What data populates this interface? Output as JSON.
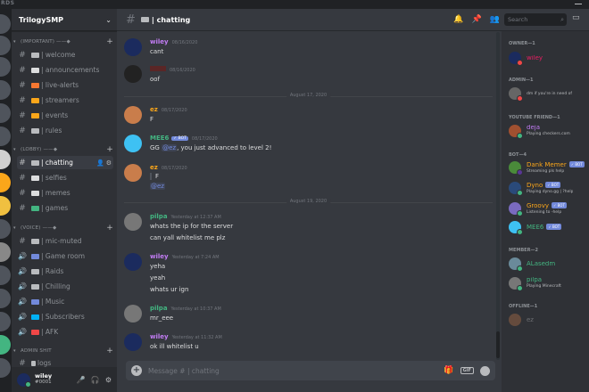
{
  "window": {
    "brand": "RDS"
  },
  "server": {
    "name": "TrilogySMP"
  },
  "categories": {
    "important": "(IMPORTANT) ——◆",
    "lobby": "(LOBBY) ——◆",
    "voice": "(VOICE) ——◆",
    "admin": "ADMIN SHIT"
  },
  "channels": [
    {
      "label": "| welcome",
      "emoji_color": "#b9bbbe"
    },
    {
      "label": "| announcements",
      "emoji_color": "#dcddde"
    },
    {
      "label": "| live-alerts",
      "emoji_color": "#f57731"
    },
    {
      "label": "| streamers",
      "emoji_color": "#faa61a"
    },
    {
      "label": "| events",
      "emoji_color": "#faa61a"
    },
    {
      "label": "| rules",
      "emoji_color": "#b9bbbe"
    },
    {
      "label": "| chatting",
      "emoji_color": "#b9bbbe"
    },
    {
      "label": "| selfies",
      "emoji_color": "#dcddde"
    },
    {
      "label": "| memes",
      "emoji_color": "#dcddde"
    },
    {
      "label": "| games",
      "emoji_color": "#43b581"
    }
  ],
  "voice_channels": [
    {
      "label": "| mic-muted",
      "emoji_color": "#b9bbbe"
    },
    {
      "label": "| Game room",
      "emoji_color": "#7289da"
    },
    {
      "label": "| Raids",
      "emoji_color": "#b9bbbe"
    },
    {
      "label": "| Chilling",
      "emoji_color": "#b9bbbe"
    },
    {
      "label": "| Music",
      "emoji_color": "#7289da"
    },
    {
      "label": "| Subscribers",
      "emoji_color": "#00b0f4"
    },
    {
      "label": "| AFK",
      "emoji_color": "#f04747"
    }
  ],
  "admin_channels": [
    {
      "label": "logs",
      "emoji_color": "#b9bbbe"
    }
  ],
  "user": {
    "name": "wiley",
    "tag": "#0001"
  },
  "header": {
    "channel": "| chatting"
  },
  "search": {
    "placeholder": "Search"
  },
  "messages": [
    {
      "user": "wiley",
      "color": "#c27cf4",
      "time": "08/16/2020",
      "lines": [
        "cant"
      ],
      "avatar": "#1b2b5e"
    },
    {
      "user": "",
      "color": "#f04747",
      "time": "08/16/2020",
      "lines": [
        "oof"
      ],
      "avatar": "#222"
    },
    {
      "divider": "August 17, 2020"
    },
    {
      "user": "ez",
      "color": "#faa61a",
      "time": "08/17/2020",
      "lines": [
        "F"
      ],
      "avatar": "#c97d4b"
    },
    {
      "user": "MEE6",
      "color": "#43b581",
      "bot": "✓ BOT",
      "time": "08/17/2020",
      "lines": [
        "GG ",
        "@ez",
        ", you just advanced to level 2!"
      ],
      "avatar": "#3ec1f3"
    },
    {
      "user": "ez",
      "color": "#faa61a",
      "time": "08/17/2020",
      "lines": [
        "F",
        "@ez"
      ],
      "avatar": "#c97d4b"
    },
    {
      "divider": "August 19, 2020"
    },
    {
      "user": "pilpa",
      "color": "#43b581",
      "time": "Yesterday at 12:37 AM",
      "lines": [
        "whats the ip for the server",
        "can yall whitelist me plz"
      ],
      "avatar": "#777"
    },
    {
      "user": "wiley",
      "color": "#c27cf4",
      "time": "Yesterday at 7:24 AM",
      "lines": [
        "yeha",
        "yeah",
        "whats ur ign"
      ],
      "avatar": "#1b2b5e"
    },
    {
      "user": "pilpa",
      "color": "#43b581",
      "time": "Yesterday at 10:37 AM",
      "lines": [
        "mr_eee"
      ],
      "avatar": "#777"
    },
    {
      "user": "wiley",
      "color": "#c27cf4",
      "time": "Yesterday at 11:32 AM",
      "lines": [
        "ok ill whitelist u"
      ],
      "avatar": "#1b2b5e"
    }
  ],
  "composer": {
    "placeholder": "Message #",
    "channel": "| chatting",
    "gif": "GIF"
  },
  "member_groups": [
    {
      "label": "OWNER—1",
      "members": [
        {
          "name": "wiley",
          "color": "#e91e63",
          "activity": "",
          "avatar": "#1b2b5e",
          "status": "#f04747"
        }
      ]
    },
    {
      "label": "ADMIN—1",
      "members": [
        {
          "name": "",
          "color": "#e74c3c",
          "activity": "dm if you're in need of",
          "avatar": "#666",
          "status": "#f04747"
        }
      ]
    },
    {
      "label": "YOUTUBE FRIEND—1",
      "members": [
        {
          "name": "deja",
          "color": "#c27cf4",
          "activity": "Playing checkers.com",
          "avatar": "#a05030",
          "status": "#43b581"
        }
      ]
    },
    {
      "label": "BOT—4",
      "members": [
        {
          "name": "Dank Memer",
          "color": "#faa61a",
          "bot": "✓ BOT",
          "activity": "Streaming pls help",
          "avatar": "#4a8a3a",
          "status": "#593695"
        },
        {
          "name": "Dyno",
          "color": "#faa61a",
          "bot": "✓ BOT",
          "activity": "Playing dyno.gg | ?help",
          "avatar": "#2a4a7a",
          "status": "#43b581"
        },
        {
          "name": "Groovy",
          "color": "#faa61a",
          "bot": "✓ BOT",
          "activity": "Listening to -help",
          "avatar": "#7a6ac0",
          "status": "#43b581"
        },
        {
          "name": "MEE6",
          "color": "#43b581",
          "bot": "✓ BOT",
          "activity": "",
          "avatar": "#3ec1f3",
          "status": "#43b581"
        }
      ]
    },
    {
      "label": "MEMBER—2",
      "members": [
        {
          "name": "ALasedm",
          "color": "#43b581",
          "activity": "",
          "avatar": "#6a8a9a",
          "status": "#43b581"
        },
        {
          "name": "pilpa",
          "color": "#43b581",
          "activity": "Playing Minecraft",
          "avatar": "#777",
          "status": "#43b581"
        }
      ]
    },
    {
      "label": "OFFLINE—1",
      "members": [
        {
          "name": "ez",
          "color": "#dcddde",
          "activity": "",
          "avatar": "#c97d4b",
          "status": "#747f8d",
          "offline": true
        }
      ]
    }
  ]
}
